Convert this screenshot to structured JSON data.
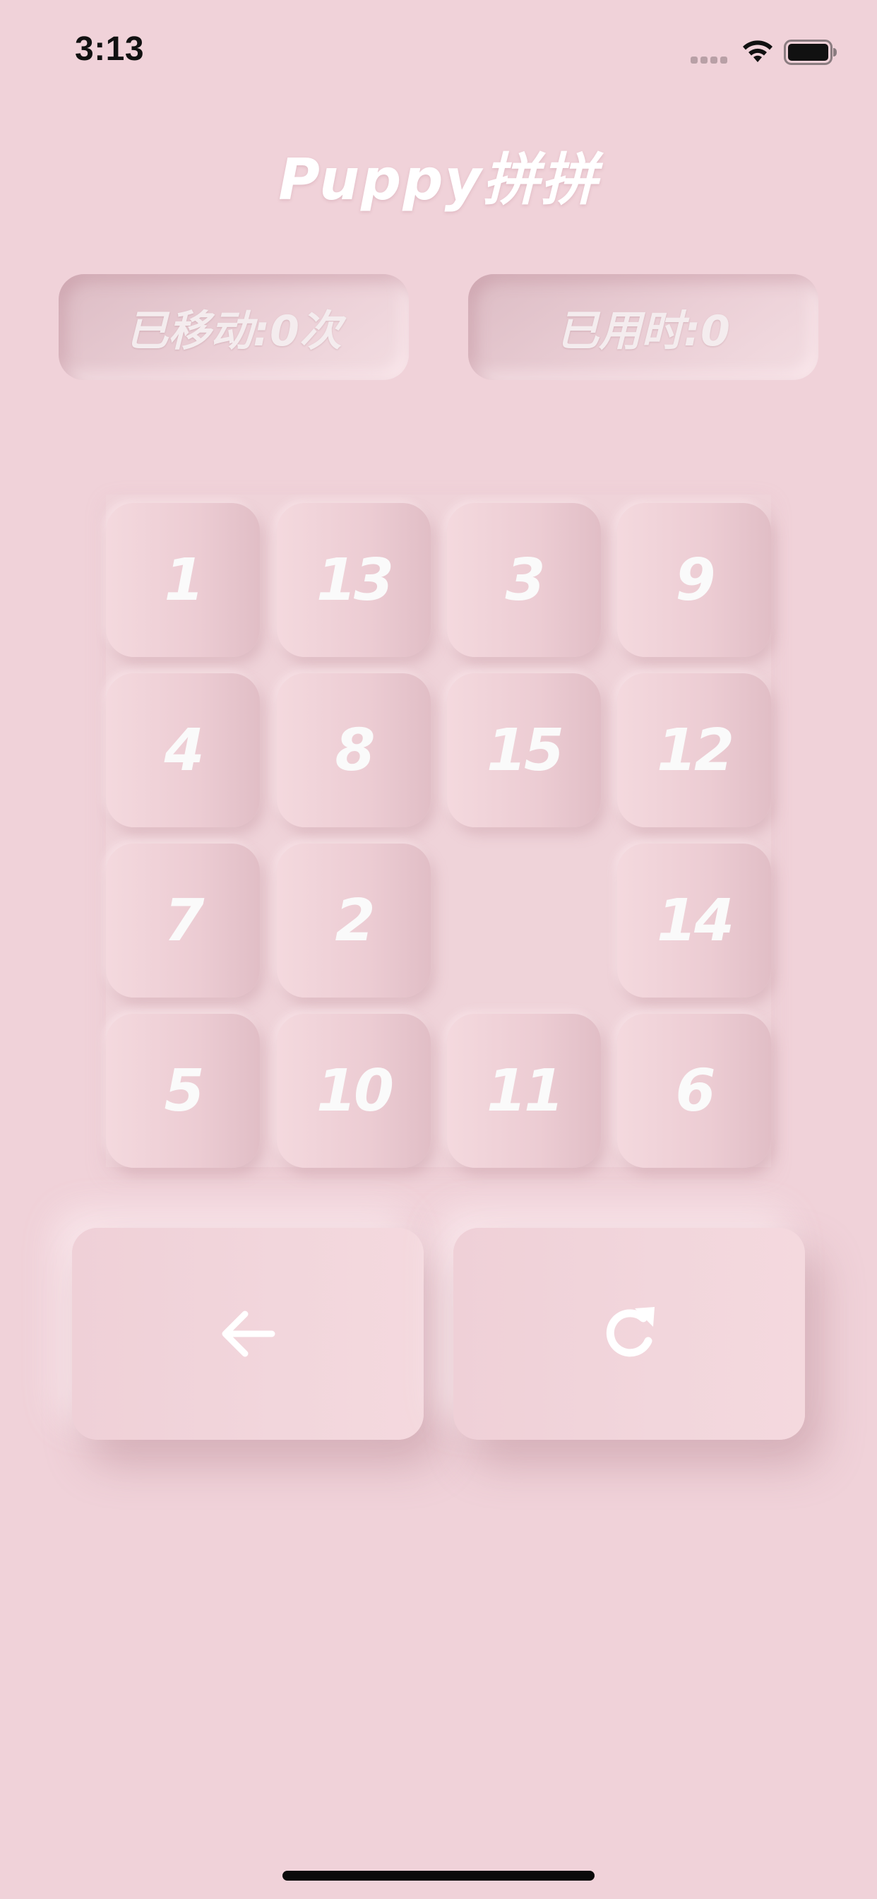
{
  "status_bar": {
    "time": "3:13"
  },
  "title": "Puppy拼拼",
  "stats": {
    "moves_label": "已移动:0次",
    "time_label": "已用时:0"
  },
  "board": {
    "rows": [
      [
        "1",
        "13",
        "3",
        "9"
      ],
      [
        "4",
        "8",
        "15",
        "12"
      ],
      [
        "7",
        "2",
        "",
        "14"
      ],
      [
        "5",
        "10",
        "11",
        "6"
      ]
    ]
  },
  "controls": {
    "undo_icon": "arrow-left-icon",
    "reset_icon": "refresh-icon"
  },
  "colors": {
    "background": "#f0d2d9",
    "text": "#ffffff"
  }
}
